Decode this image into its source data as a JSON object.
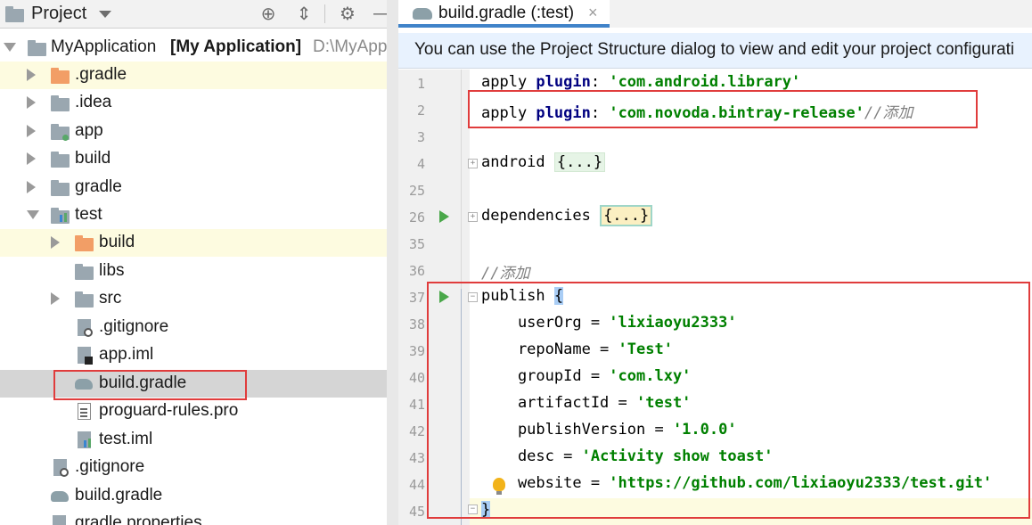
{
  "project_panel": {
    "title": "Project",
    "header_icons": [
      "target-icon",
      "collapse-icon",
      "gear-icon",
      "minimize-icon"
    ],
    "root": {
      "name": "MyApplication",
      "module": "[My Application]",
      "path": "D:\\MyAppli"
    },
    "items": [
      {
        "label": ".gradle",
        "icon": "folder-orange"
      },
      {
        "label": ".idea",
        "icon": "folder"
      },
      {
        "label": "app",
        "icon": "module-folder"
      },
      {
        "label": "build",
        "icon": "folder"
      },
      {
        "label": "gradle",
        "icon": "folder"
      },
      {
        "label": "test",
        "icon": "module-folder"
      },
      {
        "label": "build",
        "icon": "folder-orange"
      },
      {
        "label": "libs",
        "icon": "folder"
      },
      {
        "label": "src",
        "icon": "folder"
      },
      {
        "label": ".gitignore",
        "icon": "gitignore-file"
      },
      {
        "label": "app.iml",
        "icon": "iml-file"
      },
      {
        "label": "build.gradle",
        "icon": "gradle-file"
      },
      {
        "label": "proguard-rules.pro",
        "icon": "text-file"
      },
      {
        "label": "test.iml",
        "icon": "iml-file"
      },
      {
        "label": ".gitignore",
        "icon": "gitignore-file"
      },
      {
        "label": "build.gradle",
        "icon": "gradle-file"
      },
      {
        "label": "gradle.properties",
        "icon": "properties-file"
      }
    ]
  },
  "editor": {
    "tab_label": "build.gradle (:test)",
    "tab_close": "×",
    "banner": "You can use the Project Structure dialog to view and edit your project configurati",
    "line_numbers": [
      "1",
      "2",
      "3",
      "4",
      "25",
      "26",
      "35",
      "36",
      "37",
      "38",
      "39",
      "40",
      "41",
      "42",
      "43",
      "44",
      "45"
    ],
    "code": {
      "l1_a": "apply ",
      "l1_b": "plugin",
      "l1_c": ": ",
      "l1_d": "'com.android.library'",
      "l2_a": "apply ",
      "l2_b": "plugin",
      "l2_c": ": ",
      "l2_d": "'com.novoda.bintray-release'",
      "l2_e": "//添加",
      "l4_a": "android ",
      "l4_b": "{...}",
      "l26_a": "dependencies ",
      "l26_b": "{...}",
      "l36": "//添加",
      "l37_a": "publish ",
      "l37_b": "{",
      "l38_a": "    userOrg = ",
      "l38_b": "'lixiaoyu2333'",
      "l39_a": "    repoName = ",
      "l39_b": "'Test'",
      "l40_a": "    groupId = ",
      "l40_b": "'com.lxy'",
      "l41_a": "    artifactId = ",
      "l41_b": "'test'",
      "l42_a": "    publishVersion = ",
      "l42_b": "'1.0.0'",
      "l43_a": "    desc = ",
      "l43_b": "'Activity show toast'",
      "l44_a": "    website = ",
      "l44_b": "'https://github.com/lixiaoyu2333/test.git'",
      "l45": "}"
    }
  }
}
